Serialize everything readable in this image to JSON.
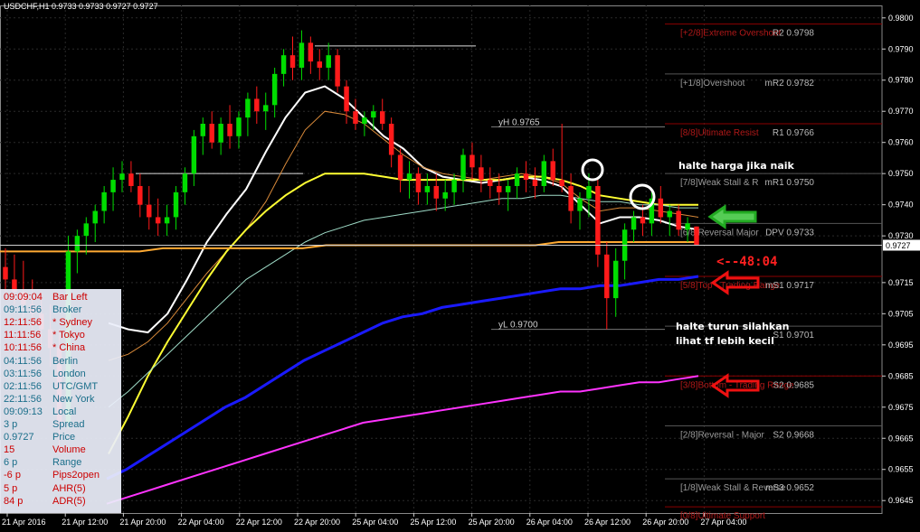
{
  "title": "USDCHF,H1  0.9733 0.9733 0.9727 0.9727",
  "colors": {
    "bg": "#000000",
    "bull": "#00dd00",
    "bear": "#ff1a1a",
    "grid": "#2a2a2a",
    "axis_text": "#ffffff",
    "level_text": "#b8b8b8",
    "ma_white": "#ffffff",
    "ma_yellow": "#ffff33",
    "ma_orange": "#d98a3a",
    "ma_teal": "#9fdcc8",
    "ma_blue": "#1a1aff",
    "ma_magenta": "#ff33ff",
    "ma_orange2": "#ffaa33",
    "murrey_red": "#8b0000",
    "murrey_gray": "#555555"
  },
  "chart_data": {
    "type": "candlestick",
    "symbol": "USDCHF",
    "timeframe": "H1",
    "ohlc_header": {
      "open": 0.9733,
      "high": 0.9733,
      "low": 0.9727,
      "close": 0.9727
    },
    "ylim": [
      0.9641,
      0.9804
    ],
    "y_ticks": [
      "0.9800",
      "0.9790",
      "0.9780",
      "0.9770",
      "0.9760",
      "0.9750",
      "0.9740",
      "0.9730",
      "0.9715",
      "0.9705",
      "0.9695",
      "0.9685",
      "0.9675",
      "0.9665",
      "0.9655",
      "0.9645"
    ],
    "y_tick_values": [
      0.98,
      0.979,
      0.978,
      0.977,
      0.976,
      0.975,
      0.974,
      0.973,
      0.9715,
      0.9705,
      0.9695,
      0.9685,
      0.9675,
      0.9665,
      0.9655,
      0.9645
    ],
    "current_price": "0.9727",
    "current_price_value": 0.9727,
    "x_ticks": [
      "21 Apr 2016",
      "21 Apr 12:00",
      "21 Apr 20:00",
      "22 Apr 04:00",
      "22 Apr 12:00",
      "22 Apr 20:00",
      "25 Apr 04:00",
      "25 Apr 12:00",
      "25 Apr 20:00",
      "26 Apr 04:00",
      "26 Apr 12:00",
      "26 Apr 20:00",
      "27 Apr 04:00"
    ],
    "candles": [
      [
        0.972,
        0.9726,
        0.9712,
        0.9716
      ],
      [
        0.9716,
        0.9724,
        0.9708,
        0.9712
      ],
      [
        0.9712,
        0.9722,
        0.9704,
        0.9708
      ],
      [
        0.9708,
        0.9716,
        0.97,
        0.9705
      ],
      [
        0.9705,
        0.9712,
        0.9695,
        0.97
      ],
      [
        0.97,
        0.9708,
        0.9688,
        0.9694
      ],
      [
        0.9694,
        0.97,
        0.966,
        0.967
      ],
      [
        0.967,
        0.973,
        0.9668,
        0.9725
      ],
      [
        0.9725,
        0.9732,
        0.9718,
        0.973
      ],
      [
        0.973,
        0.9736,
        0.9724,
        0.9734
      ],
      [
        0.9734,
        0.974,
        0.9728,
        0.9738
      ],
      [
        0.9738,
        0.9746,
        0.9734,
        0.9744
      ],
      [
        0.9744,
        0.9752,
        0.9738,
        0.9748
      ],
      [
        0.9748,
        0.9754,
        0.9744,
        0.975
      ],
      [
        0.975,
        0.9754,
        0.9744,
        0.9746
      ],
      [
        0.9746,
        0.975,
        0.9736,
        0.974
      ],
      [
        0.974,
        0.9746,
        0.9732,
        0.9736
      ],
      [
        0.9736,
        0.9742,
        0.973,
        0.9734
      ],
      [
        0.9734,
        0.974,
        0.973,
        0.9736
      ],
      [
        0.9736,
        0.9746,
        0.9732,
        0.9744
      ],
      [
        0.9744,
        0.9752,
        0.974,
        0.975
      ],
      [
        0.975,
        0.9764,
        0.9746,
        0.9762
      ],
      [
        0.9762,
        0.9768,
        0.9756,
        0.9766
      ],
      [
        0.9766,
        0.977,
        0.9758,
        0.976
      ],
      [
        0.976,
        0.9768,
        0.9756,
        0.9766
      ],
      [
        0.9766,
        0.9772,
        0.9758,
        0.9762
      ],
      [
        0.9762,
        0.977,
        0.9758,
        0.9768
      ],
      [
        0.9768,
        0.9776,
        0.9762,
        0.9774
      ],
      [
        0.9774,
        0.9778,
        0.9766,
        0.977
      ],
      [
        0.977,
        0.9776,
        0.9764,
        0.9772
      ],
      [
        0.9772,
        0.9784,
        0.9768,
        0.9782
      ],
      [
        0.9782,
        0.979,
        0.9778,
        0.9788
      ],
      [
        0.9788,
        0.9794,
        0.978,
        0.9784
      ],
      [
        0.9784,
        0.9796,
        0.978,
        0.9792
      ],
      [
        0.9792,
        0.9794,
        0.9782,
        0.9786
      ],
      [
        0.9786,
        0.979,
        0.978,
        0.9784
      ],
      [
        0.9784,
        0.9792,
        0.978,
        0.9788
      ],
      [
        0.9788,
        0.979,
        0.9776,
        0.9778
      ],
      [
        0.9778,
        0.978,
        0.9766,
        0.977
      ],
      [
        0.977,
        0.9774,
        0.9764,
        0.9766
      ],
      [
        0.9766,
        0.977,
        0.9762,
        0.9768
      ],
      [
        0.9768,
        0.9772,
        0.9764,
        0.977
      ],
      [
        0.977,
        0.9774,
        0.9764,
        0.9766
      ],
      [
        0.9766,
        0.9768,
        0.9752,
        0.9756
      ],
      [
        0.9756,
        0.9758,
        0.9744,
        0.9748
      ],
      [
        0.9748,
        0.9754,
        0.9742,
        0.975
      ],
      [
        0.975,
        0.9752,
        0.974,
        0.9744
      ],
      [
        0.9744,
        0.975,
        0.974,
        0.9746
      ],
      [
        0.9746,
        0.975,
        0.9738,
        0.9742
      ],
      [
        0.9742,
        0.9748,
        0.9738,
        0.9744
      ],
      [
        0.9744,
        0.975,
        0.974,
        0.9748
      ],
      [
        0.9748,
        0.9758,
        0.9744,
        0.9756
      ],
      [
        0.9756,
        0.976,
        0.9748,
        0.9752
      ],
      [
        0.9752,
        0.9756,
        0.9744,
        0.9748
      ],
      [
        0.9748,
        0.9752,
        0.9742,
        0.9746
      ],
      [
        0.9746,
        0.975,
        0.974,
        0.9744
      ],
      [
        0.9744,
        0.9748,
        0.9738,
        0.9746
      ],
      [
        0.9746,
        0.9752,
        0.9742,
        0.975
      ],
      [
        0.975,
        0.9754,
        0.9744,
        0.9748
      ],
      [
        0.9748,
        0.9752,
        0.9742,
        0.9746
      ],
      [
        0.9746,
        0.9756,
        0.9744,
        0.9754
      ],
      [
        0.9754,
        0.9758,
        0.9746,
        0.9748
      ],
      [
        0.9748,
        0.9766,
        0.9744,
        0.9746
      ],
      [
        0.9746,
        0.975,
        0.9734,
        0.9738
      ],
      [
        0.9738,
        0.9744,
        0.9732,
        0.9742
      ],
      [
        0.9742,
        0.975,
        0.9736,
        0.9746
      ],
      [
        0.9746,
        0.9748,
        0.972,
        0.9724
      ],
      [
        0.9724,
        0.9728,
        0.97,
        0.971
      ],
      [
        0.971,
        0.9726,
        0.9704,
        0.9722
      ],
      [
        0.9722,
        0.9734,
        0.9716,
        0.9732
      ],
      [
        0.9732,
        0.9738,
        0.9728,
        0.9736
      ],
      [
        0.9736,
        0.974,
        0.973,
        0.9734
      ],
      [
        0.9734,
        0.9744,
        0.973,
        0.9742
      ],
      [
        0.9742,
        0.9746,
        0.9734,
        0.9736
      ],
      [
        0.9736,
        0.974,
        0.973,
        0.9738
      ],
      [
        0.9738,
        0.974,
        0.973,
        0.9732
      ],
      [
        0.9732,
        0.9736,
        0.9728,
        0.9734
      ],
      [
        0.9733,
        0.9733,
        0.9727,
        0.9727
      ]
    ],
    "murrey_levels": [
      {
        "label": "[+2/8]Extreme Overshoot",
        "price": 0.9798,
        "tag": "R2 0.9798",
        "color": "red"
      },
      {
        "label": "[+1/8]Overshoot",
        "price": 0.9782,
        "tag": "mR2 0.9782",
        "color": "gray"
      },
      {
        "label": "[8/8]Ultimate Resist",
        "price": 0.9766,
        "tag": "R1 0.9766",
        "color": "red"
      },
      {
        "label": "[7/8]Weak Stall & R",
        "price": 0.975,
        "tag": "mR1 0.9750",
        "color": "gray"
      },
      {
        "label": "[6/8]Reversal Major",
        "price": 0.9734,
        "tag": "DPV 0.9733",
        "color": "gray"
      },
      {
        "label": "[5/8]Top - Trading Range",
        "price": 0.9717,
        "tag": "mS1 0.9717",
        "color": "red"
      },
      {
        "label": "",
        "price": 0.9701,
        "tag": "S1 0.9701",
        "color": "gray"
      },
      {
        "label": "[3/8]Bottom - Trading Range",
        "price": 0.9685,
        "tag": "S2 0.9685",
        "color": "red"
      },
      {
        "label": "[2/8]Reversal - Major",
        "price": 0.9669,
        "tag": "S2 0.9668",
        "color": "gray"
      },
      {
        "label": "[1/8]Weak Stall & Reverse",
        "price": 0.9652,
        "tag": "mS3 0.9652",
        "color": "gray"
      },
      {
        "label": "[0/8]Ultimate Support",
        "price": 0.9643,
        "tag": "",
        "color": "red"
      }
    ],
    "hl_labels": [
      {
        "label": "yH 0.9765",
        "price": 0.9765
      },
      {
        "label": "yL 0.9700",
        "price": 0.97
      }
    ],
    "reference_lines": [
      {
        "name": "range-high",
        "price": 0.9791
      },
      {
        "name": "range-mid",
        "price": 0.975
      }
    ],
    "moving_averages": [
      {
        "color": "white",
        "values": [
          0.9702,
          0.97,
          0.9699,
          0.9705,
          0.9716,
          0.9728,
          0.9737,
          0.9745,
          0.9757,
          0.9768,
          0.9776,
          0.9778,
          0.9774,
          0.9768,
          0.9762,
          0.9758,
          0.9752,
          0.9749,
          0.9748,
          0.9747,
          0.9748,
          0.9749,
          0.9748,
          0.9746,
          0.974,
          0.9734,
          0.9736,
          0.9736,
          0.9735,
          0.9733,
          0.9732
        ]
      },
      {
        "color": "orange",
        "values": [
          0.969,
          0.9692,
          0.9696,
          0.9702,
          0.971,
          0.9718,
          0.9725,
          0.9732,
          0.9741,
          0.9753,
          0.9764,
          0.977,
          0.9769,
          0.9766,
          0.9761,
          0.9756,
          0.9752,
          0.975,
          0.9749,
          0.9748,
          0.9749,
          0.975,
          0.9749,
          0.9747,
          0.9742,
          0.9738,
          0.9739,
          0.9739,
          0.9738,
          0.9737,
          0.9736
        ]
      },
      {
        "color": "yellow",
        "values": [
          0.966,
          0.9672,
          0.9685,
          0.9696,
          0.9706,
          0.9716,
          0.9725,
          0.9732,
          0.9738,
          0.9743,
          0.9747,
          0.975,
          0.975,
          0.975,
          0.9749,
          0.9748,
          0.9748,
          0.9748,
          0.9748,
          0.9748,
          0.9748,
          0.9749,
          0.9749,
          0.9748,
          0.9746,
          0.9743,
          0.9742,
          0.9741,
          0.974,
          0.974,
          0.974
        ]
      },
      {
        "color": "teal",
        "values": [
          0.9675,
          0.968,
          0.9686,
          0.9692,
          0.9698,
          0.9704,
          0.971,
          0.9716,
          0.972,
          0.9724,
          0.9728,
          0.9731,
          0.9733,
          0.9735,
          0.9736,
          0.9737,
          0.9738,
          0.9739,
          0.974,
          0.9741,
          0.9742,
          0.9742,
          0.9743,
          0.9743,
          0.9742,
          0.9741,
          0.9741,
          0.974,
          0.974,
          0.9739,
          0.9739
        ]
      },
      {
        "color": "orange2",
        "values": [
          0.9725,
          0.9725,
          0.9725,
          0.9725,
          0.9725,
          0.9725,
          0.9725,
          0.9726,
          0.9726,
          0.9726,
          0.9726,
          0.9726,
          0.9726,
          0.9726,
          0.9727,
          0.9727,
          0.9727,
          0.9727,
          0.9727,
          0.9727,
          0.9727,
          0.9727,
          0.9727,
          0.9727,
          0.9728,
          0.9728,
          0.9728,
          0.9728,
          0.9728,
          0.9728,
          0.9728
        ]
      },
      {
        "color": "blue",
        "values": [
          0.9652,
          0.9655,
          0.9659,
          0.9663,
          0.9667,
          0.9671,
          0.9675,
          0.9678,
          0.9682,
          0.9686,
          0.969,
          0.9693,
          0.9696,
          0.9699,
          0.9702,
          0.9704,
          0.9705,
          0.9707,
          0.9708,
          0.9709,
          0.971,
          0.9711,
          0.9712,
          0.9713,
          0.9713,
          0.9714,
          0.9714,
          0.9715,
          0.9716,
          0.9716,
          0.9717
        ]
      },
      {
        "color": "magenta",
        "values": [
          0.9644,
          0.9646,
          0.9648,
          0.965,
          0.9652,
          0.9654,
          0.9656,
          0.9658,
          0.966,
          0.9662,
          0.9664,
          0.9666,
          0.9668,
          0.967,
          0.9671,
          0.9672,
          0.9673,
          0.9674,
          0.9675,
          0.9676,
          0.9677,
          0.9678,
          0.9679,
          0.968,
          0.968,
          0.9681,
          0.9682,
          0.9683,
          0.9683,
          0.9684,
          0.9685
        ]
      }
    ]
  },
  "info_panel": {
    "rows": [
      {
        "value": "09:09:04",
        "name": "Bar Left",
        "color": "#cc0000"
      },
      {
        "value": "09:11:56",
        "name": "Broker",
        "color": "#1a6e8a"
      },
      {
        "value": "12:11:56",
        "name": "* Sydney",
        "color": "#cc0000"
      },
      {
        "value": "11:11:56",
        "name": "* Tokyo",
        "color": "#cc0000"
      },
      {
        "value": "10:11:56",
        "name": "* China",
        "color": "#cc0000"
      },
      {
        "value": "04:11:56",
        "name": "Berlin",
        "color": "#1a6e8a"
      },
      {
        "value": "03:11:56",
        "name": "London",
        "color": "#1a6e8a"
      },
      {
        "value": "02:11:56",
        "name": "UTC/GMT",
        "color": "#1a6e8a"
      },
      {
        "value": "22:11:56",
        "name": "New York",
        "color": "#1a6e8a"
      },
      {
        "value": "09:09:13",
        "name": "Local",
        "color": "#1a6e8a"
      },
      {
        "value": "3 p",
        "name": "Spread",
        "color": "#1a6e8a"
      },
      {
        "value": "0.9727",
        "name": "Price",
        "color": "#1a6e8a"
      },
      {
        "value": "15",
        "name": "Volume",
        "color": "#cc0000"
      },
      {
        "value": "6 p",
        "name": "Range",
        "color": "#1a6e8a"
      },
      {
        "value": "-6 p",
        "name": "Pips2open",
        "color": "#cc0000"
      },
      {
        "value": "5 p",
        "name": "AHR(5)",
        "color": "#cc0000"
      },
      {
        "value": "84 p",
        "name": "ADR(5)",
        "color": "#cc0000"
      }
    ]
  },
  "annotations": {
    "note_up": "halte harga jika naik",
    "note_down_1": "halte turun silahkan",
    "note_down_2": "lihat tf lebih kecil",
    "timer": "<--48:04"
  }
}
